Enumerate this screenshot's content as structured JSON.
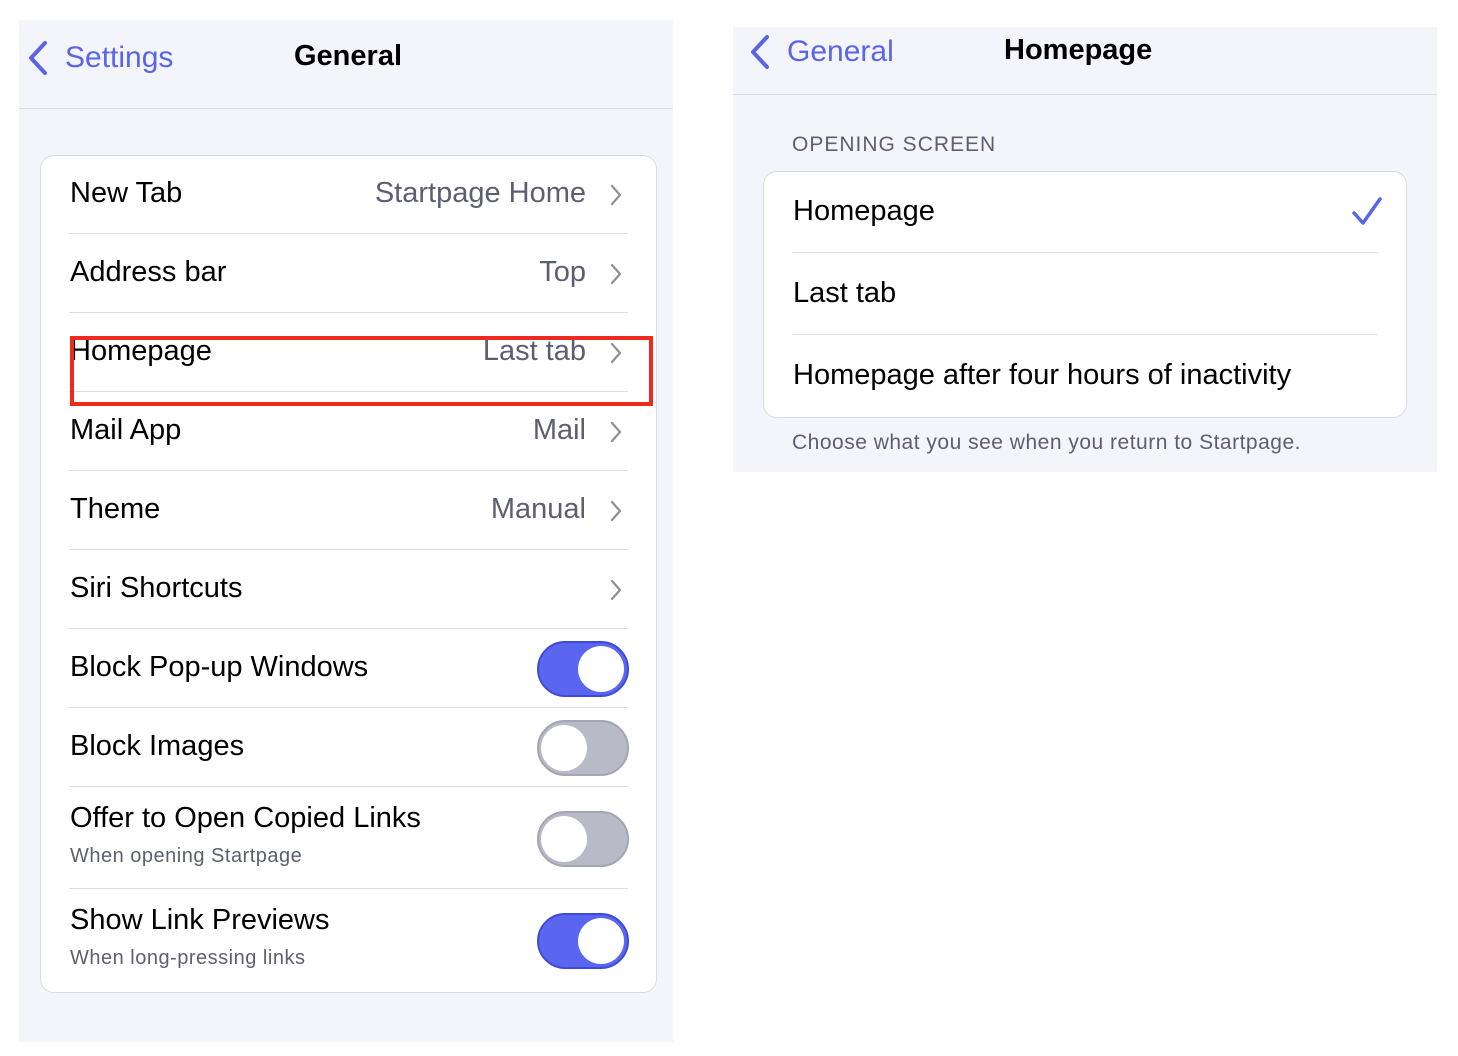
{
  "colors": {
    "accent": "#5865e8",
    "highlight": "#ee2a1f",
    "panel_bg": "#f4f4fb",
    "toggle_on": "#5a66ef",
    "toggle_off": "#b9bac8"
  },
  "general_screen": {
    "back_label": "Settings",
    "title": "General",
    "rows": [
      {
        "label": "New Tab",
        "value": "Startpage Home",
        "icon": "chevron-right-icon"
      },
      {
        "label": "Address bar",
        "value": "Top",
        "icon": "chevron-right-icon"
      },
      {
        "label": "Homepage",
        "value": "Last tab",
        "icon": "chevron-right-icon",
        "highlighted": true
      },
      {
        "label": "Mail App",
        "value": "Mail",
        "icon": "chevron-right-icon"
      },
      {
        "label": "Theme",
        "value": "Manual",
        "icon": "chevron-right-icon"
      },
      {
        "label": "Siri Shortcuts",
        "value": "",
        "icon": "chevron-right-icon"
      },
      {
        "label": "Block Pop-up Windows",
        "toggle": true
      },
      {
        "label": "Block Images",
        "toggle": false
      },
      {
        "label": "Offer to Open Copied Links",
        "subtitle": "When opening Startpage",
        "toggle": false
      },
      {
        "label": "Show Link Previews",
        "subtitle": "When long-pressing links",
        "toggle": true
      }
    ]
  },
  "homepage_screen": {
    "back_label": "General",
    "title": "Homepage",
    "section_header": "OPENING SCREEN",
    "options": [
      {
        "label": "Homepage",
        "selected": true
      },
      {
        "label": "Last tab",
        "selected": false
      },
      {
        "label": "Homepage after four hours of inactivity",
        "selected": false
      }
    ],
    "section_footer": "Choose what you see when you return to Startpage."
  }
}
